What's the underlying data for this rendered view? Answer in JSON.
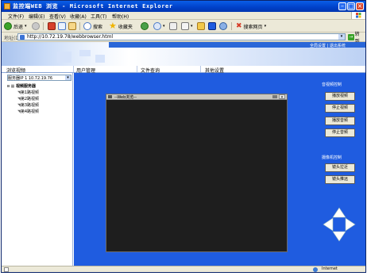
{
  "browser": {
    "title": "监控端WEB 浏览 - Microsoft Internet Explorer",
    "menu": [
      "文件(F)",
      "编辑(E)",
      "查看(V)",
      "收藏(A)",
      "工具(T)",
      "帮助(H)"
    ],
    "toolbar": {
      "back_label": "后退",
      "search_label": "搜索",
      "favorites_label": "收藏夹",
      "search_web_label": "搜索网页"
    },
    "address": {
      "label": "地址(D)",
      "url": "http://10.72.19.78/webbrowser.html",
      "go_label": "转到"
    },
    "status": {
      "zone": "Internet"
    }
  },
  "page": {
    "banner_links": "全局设置 | 退出系统",
    "nav": [
      "浏览视频",
      "用户管理",
      "文件查询",
      "其他设置"
    ],
    "server_select": "服务器IP 1 10.72.19.76",
    "tree": {
      "root": "视频服务器",
      "channels": [
        "第1路视频",
        "第2路视频",
        "第3路视频",
        "第4路视频"
      ]
    },
    "player": {
      "title": "--Web浏览--"
    },
    "av_control": {
      "title": "音视频控制",
      "buttons": [
        "播放视频",
        "停止视频",
        "播放音频",
        "停止音频"
      ]
    },
    "camera_control": {
      "title": "摄像机控制",
      "buttons": [
        "镜头拉近",
        "镜头推远"
      ]
    },
    "ptz_icons": [
      "arrow-up-icon",
      "arrow-left-icon",
      "arrow-right-icon",
      "arrow-down-icon"
    ],
    "colors": {
      "main_bg": "#1f5ce0",
      "title_bar": "#0040c8",
      "player_bg": "#1e1e1e"
    }
  }
}
